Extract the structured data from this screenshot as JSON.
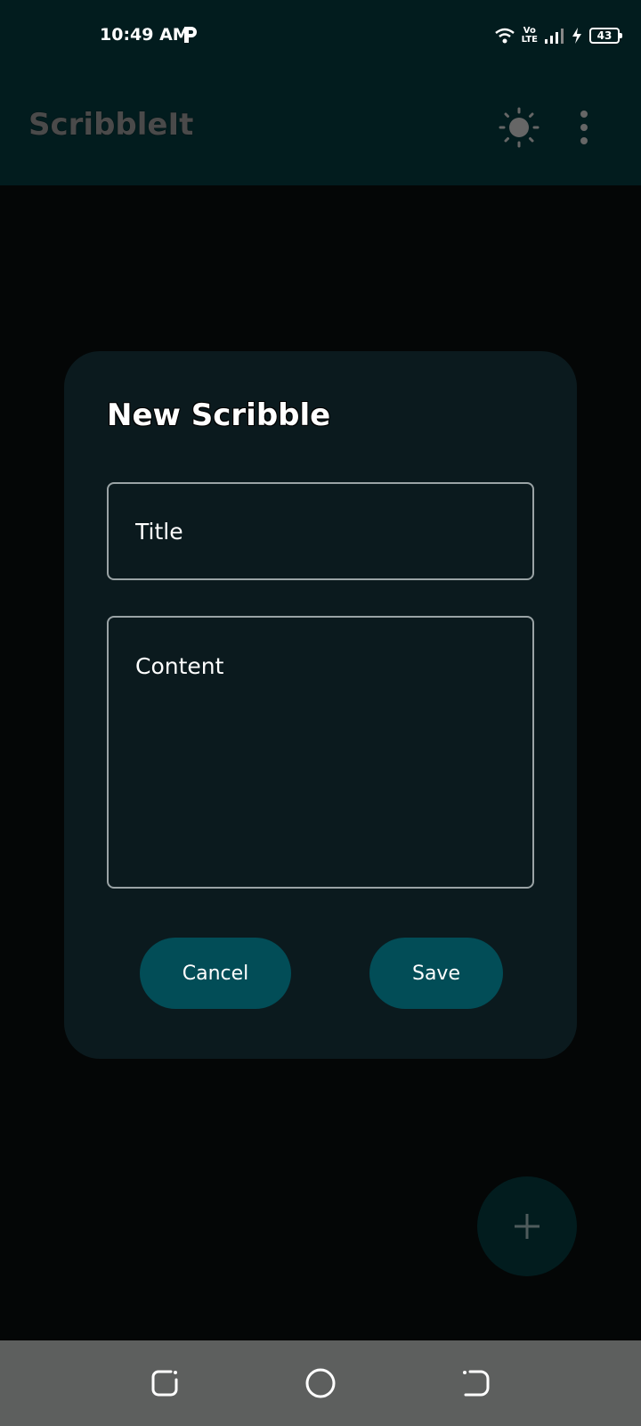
{
  "status_bar": {
    "time": "10:49 AM",
    "network_label": "Vo\nLTE",
    "battery": "43"
  },
  "app_bar": {
    "title": "ScribbleIt"
  },
  "dialog": {
    "title": "New Scribble",
    "title_placeholder": "Title",
    "content_placeholder": "Content",
    "cancel_label": "Cancel",
    "save_label": "Save"
  },
  "colors": {
    "app_bar": "#021c1e",
    "background": "#040606",
    "dialog": "#0b1a1e",
    "button": "#024d57",
    "nav_bar": "#5d5f5e"
  },
  "icons": {
    "theme": "sun-icon",
    "more": "more-vertical-icon",
    "fab": "plus-icon"
  }
}
